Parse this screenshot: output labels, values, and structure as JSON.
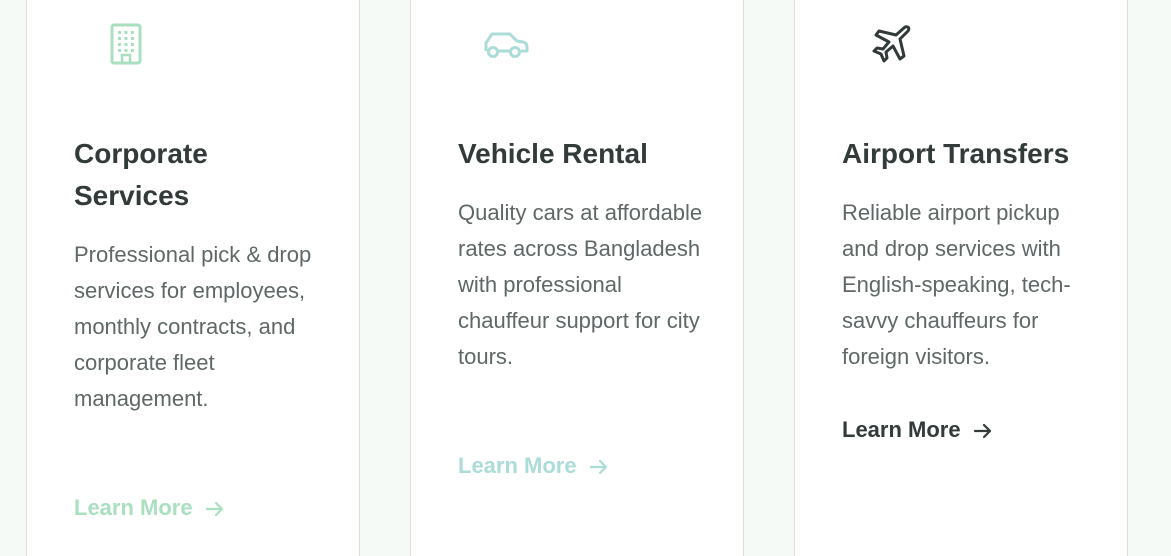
{
  "cards": [
    {
      "title": "Corporate Services",
      "description": "Professional pick & drop services for employees, monthly contracts, and corporate fleet management.",
      "link_label": "Learn More",
      "icon": "building-icon",
      "accent": "#aadfc0"
    },
    {
      "title": "Vehicle Rental",
      "description": "Quality cars at affordable rates across Bangladesh with professional chauffeur support for city tours.",
      "link_label": "Learn More",
      "icon": "car-icon",
      "accent": "#abdcd8"
    },
    {
      "title": "Airport Transfers",
      "description": "Reliable airport pickup and drop services with English-speaking, tech-savvy chauffeurs for foreign visitors.",
      "link_label": "Learn More",
      "icon": "airplane-icon",
      "accent": "#333a3a"
    }
  ]
}
